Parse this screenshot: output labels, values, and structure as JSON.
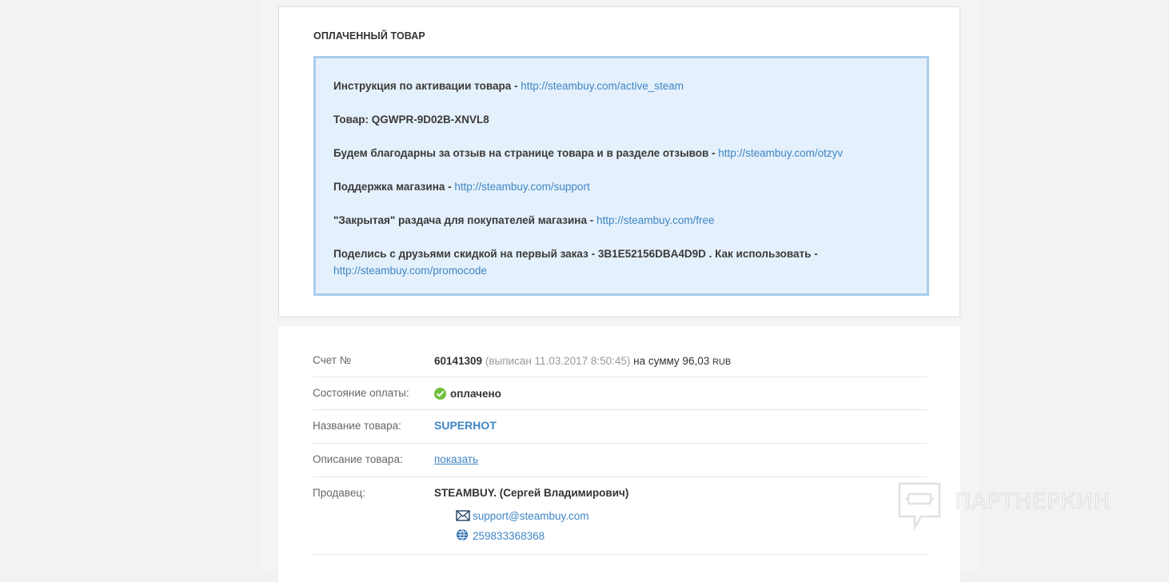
{
  "paid_section": {
    "title": "ОПЛАЧЕННЫЙ ТОВАР",
    "lines": [
      {
        "text": "Инструкция по активации товара - ",
        "link": "http://steambuy.com/active_steam"
      },
      {
        "text": "Товар: QGWPR-9D02B-XNVL8",
        "link": ""
      },
      {
        "text": "Будем благодарны за отзыв на странице товара и в разделе отзывов - ",
        "link": "http://steambuy.com/otzyv"
      },
      {
        "text": "Поддержка магазина - ",
        "link": "http://steambuy.com/support"
      },
      {
        "text": "\"Закрытая\" раздача для покупателей магазина - ",
        "link": "http://steambuy.com/free"
      },
      {
        "text": "Поделись с друзьями скидкой на первый заказ - 3B1E52156DBA4D9D . Как использовать -",
        "link": "http://steambuy.com/promocode"
      }
    ]
  },
  "invoice": {
    "rows": {
      "account": {
        "label": "Счет №",
        "number": "60141309",
        "issued": "(выписан 11.03.2017 8:50:45)",
        "sum_text": "на сумму 96,03",
        "currency": "RUB"
      },
      "status": {
        "label": "Состояние оплаты:",
        "value": "оплачено",
        "icon": "check-circle-icon",
        "color": "#6dbf3b"
      },
      "product": {
        "label": "Название товара:",
        "value": "SUPERHOT"
      },
      "description": {
        "label": "Описание товара:",
        "value": "показать"
      },
      "seller": {
        "label": "Продавец:",
        "value": "STEAMBUY. (Сергей Владимирович)",
        "email": "support@steambuy.com",
        "wmid": "259833368368"
      }
    }
  },
  "watermark": {
    "text": "ПАРТНЕРКИН"
  },
  "colors": {
    "link": "#3f86c6",
    "box_bg": "#e4f0fb",
    "box_border": "#a9cdec"
  }
}
